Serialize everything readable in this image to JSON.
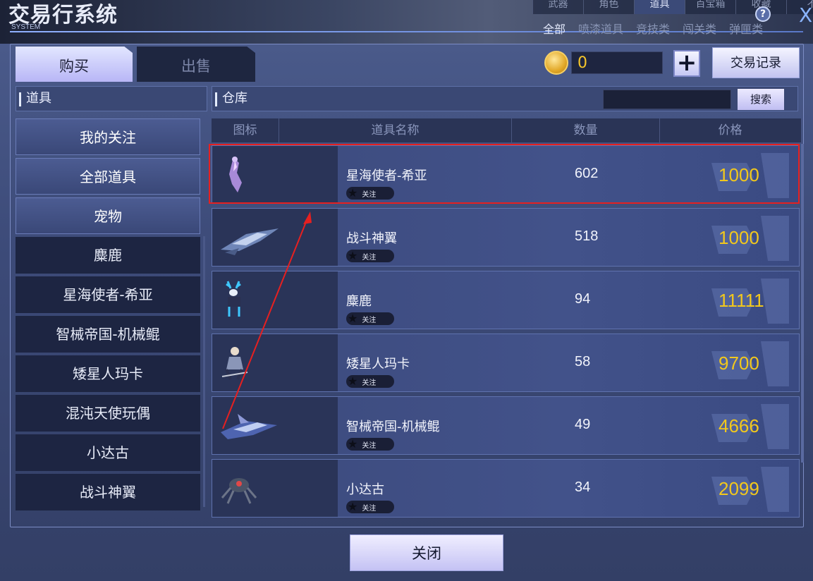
{
  "window": {
    "title": "交易行系统",
    "subtitle": "SYSTEM",
    "help_label": "?",
    "close_label": "X"
  },
  "top_tabs": [
    "武器",
    "角色",
    "道具",
    "百宝箱",
    "收藏",
    "不"
  ],
  "top_tabs_active_index": 2,
  "sub_tabs": [
    "全部",
    "喷漆道具",
    "竞技类",
    "闯关类",
    "弹匣类"
  ],
  "sub_tabs_active_index": 0,
  "mode_tabs": {
    "buy": "购买",
    "sell": "出售",
    "active": "buy"
  },
  "currency": {
    "amount": "0",
    "add_label": "+",
    "record_label": "交易记录"
  },
  "left_panel": {
    "header": "道具",
    "categories": [
      "我的关注",
      "全部道具",
      "宠物",
      "麋鹿",
      "星海使者-希亚",
      "智械帝国-机械鲲",
      "矮星人玛卡",
      "混沌天使玩偶",
      "小达古",
      "战斗神翼"
    ]
  },
  "right_panel": {
    "header": "仓库",
    "search_value": "",
    "search_label": "搜索",
    "columns": [
      "图标",
      "道具名称",
      "数量",
      "价格"
    ],
    "rows": [
      {
        "name": "星海使者-希亚",
        "qty": "602",
        "price": "1000",
        "fav": "关注",
        "icon": "starsea-envoy-figure-icon"
      },
      {
        "name": "战斗神翼",
        "qty": "518",
        "price": "1000",
        "fav": "关注",
        "icon": "battle-wing-ship-icon"
      },
      {
        "name": "麋鹿",
        "qty": "94",
        "price": "11111",
        "fav": "关注",
        "icon": "elk-pet-icon"
      },
      {
        "name": "矮星人玛卡",
        "qty": "58",
        "price": "9700",
        "fav": "关注",
        "icon": "dwarf-maka-figure-icon"
      },
      {
        "name": "智械帝国-机械鲲",
        "qty": "49",
        "price": "4666",
        "fav": "关注",
        "icon": "mech-kun-ship-icon"
      },
      {
        "name": "小达古",
        "qty": "34",
        "price": "2099",
        "fav": "关注",
        "icon": "spider-mech-pet-icon"
      }
    ]
  },
  "footer": {
    "close_label": "关闭"
  },
  "colors": {
    "price": "#f2c81c",
    "annotation": "#e62020",
    "accent_button": "#c4c2f4"
  }
}
